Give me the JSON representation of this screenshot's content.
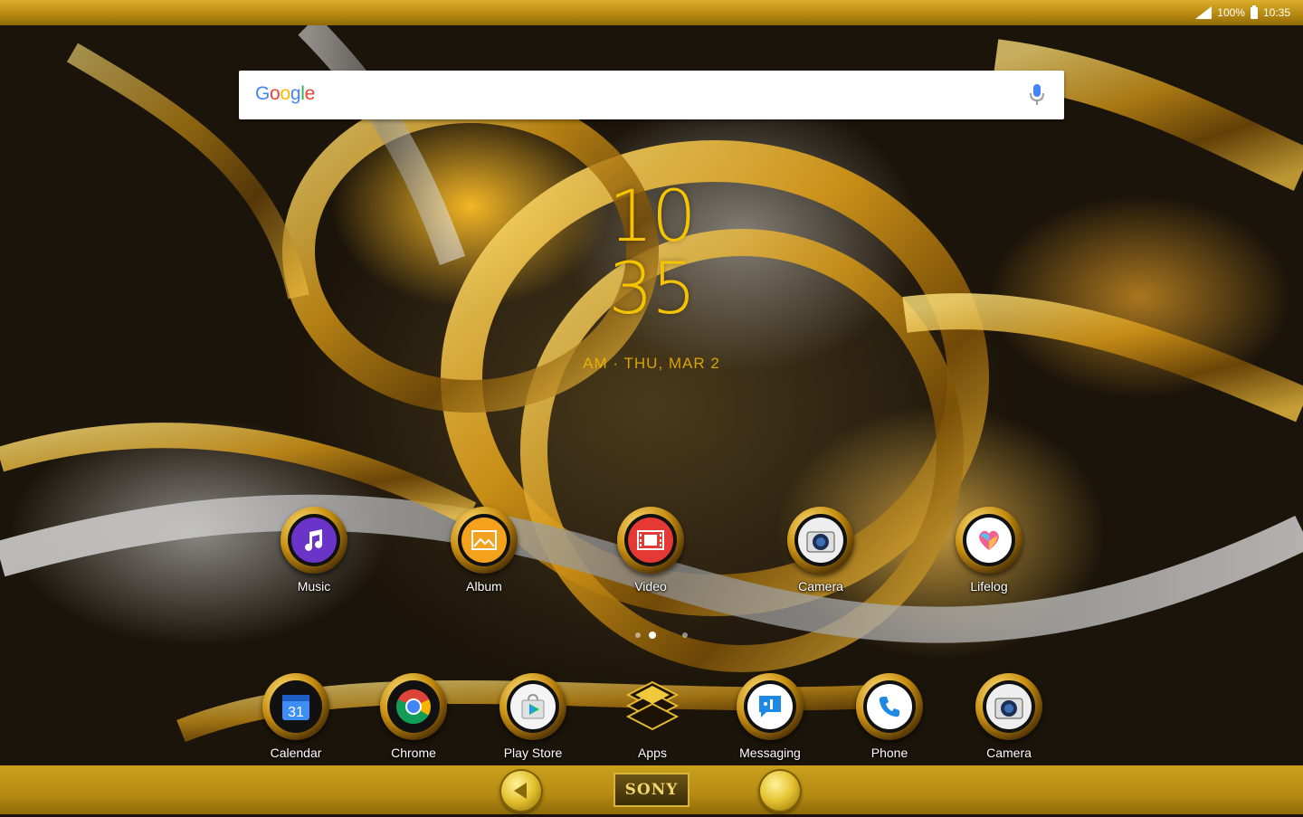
{
  "status_bar": {
    "battery": "100%",
    "time": "10:35"
  },
  "search": {
    "logo": "Google",
    "placeholder": "",
    "mic_icon": "mic-icon"
  },
  "clock": {
    "hour": "10",
    "minute": "35",
    "date": "AM · THU, MAR 2"
  },
  "apps_row1": [
    {
      "label": "Music",
      "icon": "music-note-icon",
      "color": "#6a34c9"
    },
    {
      "label": "Album",
      "icon": "picture-icon",
      "color": "#f4a21e"
    },
    {
      "label": "Video",
      "icon": "film-icon",
      "color": "#e53935"
    },
    {
      "label": "Camera",
      "icon": "camera-icon",
      "color": "#eeeeee"
    },
    {
      "label": "Lifelog",
      "icon": "heart-icon",
      "color": "#ffffff"
    }
  ],
  "dock": [
    {
      "label": "Calendar",
      "icon": "calendar-icon",
      "value": "31"
    },
    {
      "label": "Chrome",
      "icon": "chrome-icon"
    },
    {
      "label": "Play Store",
      "icon": "play-store-icon"
    },
    {
      "label": "Apps",
      "icon": "apps-drawer-icon"
    },
    {
      "label": "Messaging",
      "icon": "message-icon"
    },
    {
      "label": "Phone",
      "icon": "phone-icon"
    },
    {
      "label": "Camera",
      "icon": "camera-icon"
    }
  ],
  "page_indicator": {
    "pages": 3,
    "active": 2
  },
  "nav": {
    "back_icon": "back-icon",
    "home_label": "SONY",
    "recents_icon": "recents-icon"
  },
  "colors": {
    "gold": "#f5c400",
    "bar_gold": "#b98a12"
  }
}
